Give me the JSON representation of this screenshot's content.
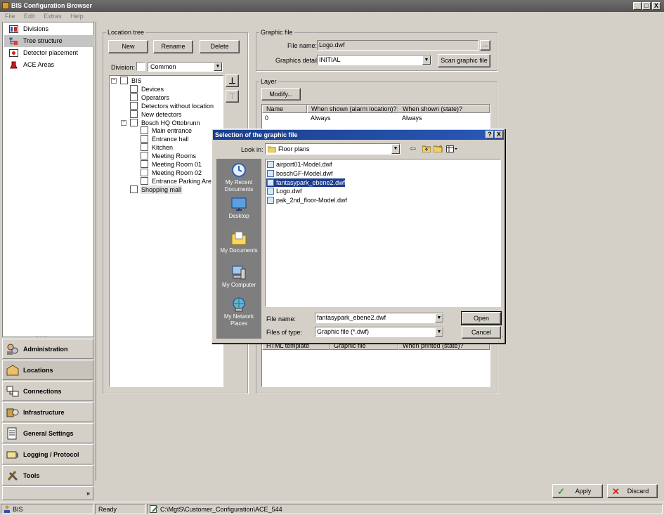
{
  "window": {
    "title": "BIS Configuration Browser",
    "controls": [
      "_",
      "□",
      "X"
    ]
  },
  "menu": [
    "File",
    "Edit",
    "Extras",
    "Help"
  ],
  "nav_items": [
    {
      "label": "Divisions",
      "icon": "divisions-icon"
    },
    {
      "label": "Tree structure",
      "icon": "tree-icon",
      "selected": true
    },
    {
      "label": "Detector placement",
      "icon": "detector-icon"
    },
    {
      "label": "ACE Areas",
      "icon": "ace-area-icon"
    }
  ],
  "splitter_dots": "........",
  "sections": [
    {
      "label": "Administration",
      "icon": "administration-icon"
    },
    {
      "label": "Locations",
      "icon": "locations-icon",
      "selected": true
    },
    {
      "label": "Connections",
      "icon": "connections-icon"
    },
    {
      "label": "Infrastructure",
      "icon": "infrastructure-icon"
    },
    {
      "label": "General Settings",
      "icon": "settings-icon"
    },
    {
      "label": "Logging / Protocol",
      "icon": "logging-icon"
    },
    {
      "label": "Tools",
      "icon": "tools-icon"
    }
  ],
  "more_chevron": "»",
  "location_tree": {
    "group_label": "Location tree",
    "new_label": "New",
    "rename_label": "Rename",
    "delete_label": "Delete",
    "division_label": "Division:",
    "division_value": "Common",
    "nodes": [
      {
        "label": "BIS",
        "level": 0,
        "expander": "−"
      },
      {
        "label": "Devices",
        "level": 1
      },
      {
        "label": "Operators",
        "level": 1
      },
      {
        "label": "Detectors without location",
        "level": 1
      },
      {
        "label": "New detectors",
        "level": 1
      },
      {
        "label": "Bosch HQ Ottobrunn",
        "level": 1,
        "expander": "−"
      },
      {
        "label": "Main entrance",
        "level": 2
      },
      {
        "label": "Entrance hall",
        "level": 2
      },
      {
        "label": "Kitchen",
        "level": 2
      },
      {
        "label": "Meeting Rooms",
        "level": 2
      },
      {
        "label": "Meeting Room 01",
        "level": 2
      },
      {
        "label": "Meeting Room 02",
        "level": 2
      },
      {
        "label": "Entrance Parking Area",
        "level": 2
      },
      {
        "label": "Shopping mall",
        "level": 1,
        "highlight": true
      }
    ],
    "move_up_icon": "move-up-icon",
    "move_top_icon": "move-top-icon"
  },
  "graphic_file": {
    "group_label": "Graphic file",
    "file_name_label": "File name:",
    "file_name_value": "Logo.dwf",
    "browse_label": "...",
    "detail_label": "Graphics detail:",
    "detail_value": "INITIAL",
    "scan_label": "Scan graphic file"
  },
  "layer": {
    "group_label": "Layer",
    "modify_label": "Modify...",
    "columns": [
      "Name",
      "When shown (alarm location)?",
      "When shown (state)?"
    ],
    "rows": [
      [
        "0",
        "Always",
        "Always"
      ]
    ]
  },
  "print": {
    "columns": [
      "HTML template",
      "Graphic file",
      "When printed (state)?"
    ]
  },
  "dialog": {
    "title": "Selection of the graphic file",
    "help": "?",
    "close": "X",
    "look_in_label": "Look in:",
    "look_in_value": "Floor plans",
    "places": [
      {
        "label": "My Recent Documents",
        "icon": "recent-documents-icon"
      },
      {
        "label": "Desktop",
        "icon": "desktop-icon"
      },
      {
        "label": "My Documents",
        "icon": "my-documents-icon"
      },
      {
        "label": "My Computer",
        "icon": "my-computer-icon"
      },
      {
        "label": "My Network Places",
        "icon": "network-places-icon"
      }
    ],
    "files": [
      {
        "name": "airport01-Model.dwf"
      },
      {
        "name": "boschGF-Model.dwf"
      },
      {
        "name": "fantasypark_ebene2.dwf",
        "selected": true
      },
      {
        "name": "Logo.dwf"
      },
      {
        "name": "pak_2nd_floor-Model.dwf"
      }
    ],
    "file_name_label": "File name:",
    "file_name_value": "fantasypark_ebene2.dwf",
    "file_type_label": "Files of type:",
    "file_type_value": "Graphic file (*.dwf)",
    "open_label": "Open",
    "cancel_label": "Cancel"
  },
  "footer": {
    "apply_label": "Apply",
    "discard_label": "Discard"
  },
  "status": {
    "user": "BIS",
    "state": "Ready",
    "path": "C:\\MgtS\\Customer_Configuration\\ACE_544"
  }
}
